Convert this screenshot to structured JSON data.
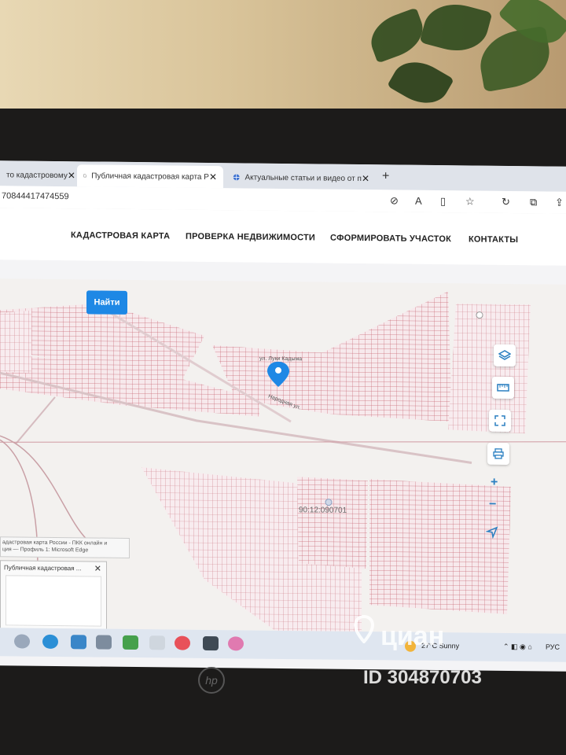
{
  "browser": {
    "tabs": [
      {
        "label": "то кадастровому",
        "active": false
      },
      {
        "label": "Публичная кадастровая карта Р",
        "active": true
      },
      {
        "label": "Актуальные статьи и видео от п",
        "active": false
      }
    ],
    "new_tab": "+",
    "close": "✕",
    "url": "70844417474559"
  },
  "site_nav": {
    "items": [
      "КАДАСТРОВАЯ КАРТА",
      "ПРОВЕРКА НЕДВИЖИМОСТИ",
      "СФОРМИРОВАТЬ УЧАСТОК",
      "КОНТАКТЫ"
    ]
  },
  "map": {
    "find_button": "Найти",
    "cadastral_number": "90:12:090701",
    "street_1": "ул. Луки Кадыма",
    "street_2": "Народная ул.",
    "zoom_in": "+",
    "zoom_out": "−",
    "popup_line1": "адастровая карта России - ПКК онлайн и",
    "popup_line2": "ция — Профиль 1: Microsoft Edge",
    "thumb_title": "Публичная кадастровая ...",
    "thumb_close": "✕"
  },
  "taskbar": {
    "weather": "27°C  Sunny",
    "lang": "РУС"
  },
  "watermark": {
    "brand": "циан",
    "id": "ID 304870703"
  },
  "colors": {
    "accent": "#1e88e5",
    "parcel": "#c96b78",
    "map_bg": "#f3f1ef"
  }
}
